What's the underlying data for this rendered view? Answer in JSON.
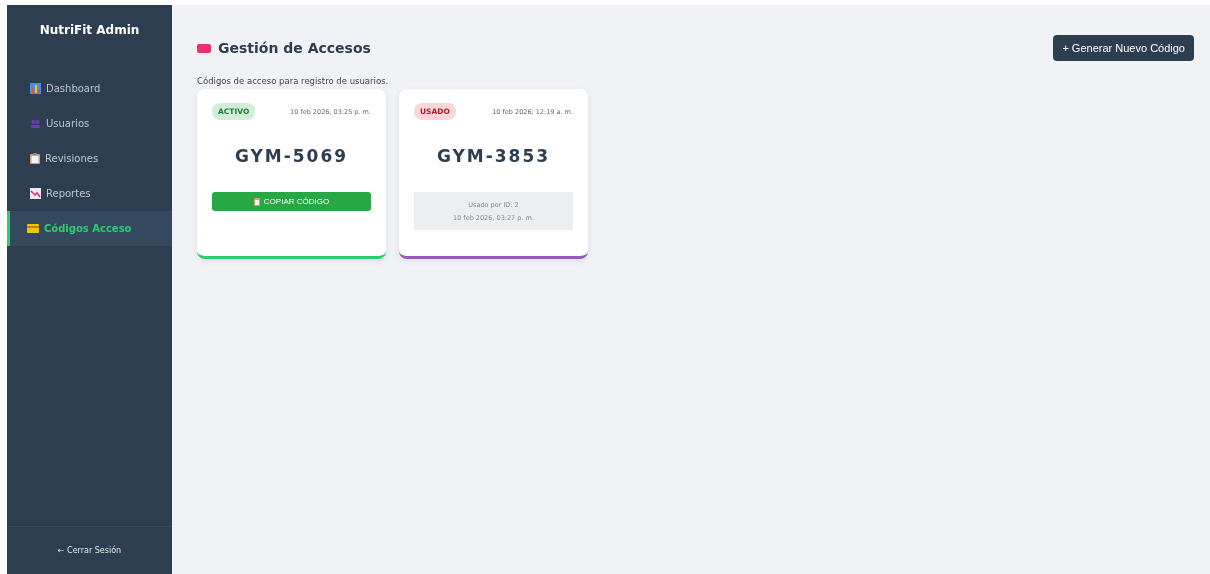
{
  "sidebar": {
    "title": "NutriFit Admin",
    "items": [
      {
        "label": "Dashboard",
        "kind": "chart",
        "selected": false
      },
      {
        "label": "Usuarios",
        "kind": "users",
        "selected": false
      },
      {
        "label": "Revisiones",
        "kind": "clipboard",
        "selected": false
      },
      {
        "label": "Reportes",
        "kind": "trend",
        "selected": false
      },
      {
        "label": "Códigos Acceso",
        "kind": "card",
        "selected": true
      }
    ],
    "logout": "← Cerrar Sesión"
  },
  "header": {
    "title": "Gestión de Accesos",
    "button": "+ Generar Nuevo Código"
  },
  "subtitle": "Códigos de acceso para registro de usuarios.",
  "cards": [
    {
      "kind": "active",
      "status": "ACTIVO",
      "date": "10 feb 2026, 03:25 p. m.",
      "code": "GYM-5069",
      "color": "#2ecc71",
      "action": "COPIAR CÓDIGO"
    },
    {
      "kind": "used",
      "status": "USADO",
      "date": "10 feb 2026, 12:19 a. m.",
      "code": "GYM-3853",
      "color": "#9b59b6",
      "used_by": "Usado por ID: 2",
      "used_date": "10 feb 2026, 03:27 p. m."
    }
  ]
}
